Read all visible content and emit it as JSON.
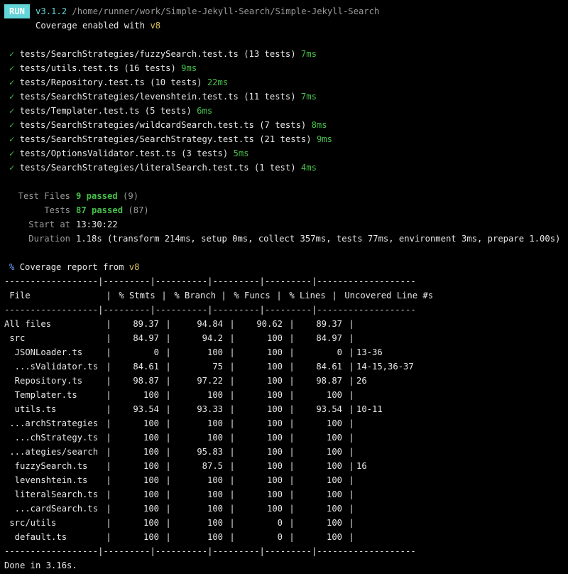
{
  "header": {
    "badge": "RUN",
    "version": "v3.1.2",
    "path": "/home/runner/work/Simple-Jekyll-Search/Simple-Jekyll-Search",
    "coverage_text": "Coverage enabled with ",
    "coverage_provider": "v8"
  },
  "tests": [
    {
      "check": "✓",
      "name": "tests/SearchStrategies/fuzzySearch.test.ts (13 tests)",
      "time": "7ms"
    },
    {
      "check": "✓",
      "name": "tests/utils.test.ts (16 tests)",
      "time": "9ms"
    },
    {
      "check": "✓",
      "name": "tests/Repository.test.ts (10 tests)",
      "time": "22ms"
    },
    {
      "check": "✓",
      "name": "tests/SearchStrategies/levenshtein.test.ts (11 tests)",
      "time": "7ms"
    },
    {
      "check": "✓",
      "name": "tests/Templater.test.ts (5 tests)",
      "time": "6ms"
    },
    {
      "check": "✓",
      "name": "tests/SearchStrategies/wildcardSearch.test.ts (7 tests)",
      "time": "8ms"
    },
    {
      "check": "✓",
      "name": "tests/SearchStrategies/SearchStrategy.test.ts (21 tests)",
      "time": "9ms"
    },
    {
      "check": "✓",
      "name": "tests/OptionsValidator.test.ts (3 tests)",
      "time": "5ms"
    },
    {
      "check": "✓",
      "name": "tests/SearchStrategies/literalSearch.test.ts (1 test)",
      "time": "4ms"
    }
  ],
  "summary": {
    "files_label": "Test Files",
    "files_passed": "9 passed",
    "files_total": "(9)",
    "tests_label": "Tests",
    "tests_passed": "87 passed",
    "tests_total": "(87)",
    "start_label": "Start at",
    "start_value": "13:30:22",
    "duration_label": "Duration",
    "duration_value": "1.18s",
    "duration_detail": "(transform 214ms, setup 0ms, collect 357ms, tests 77ms, environment 3ms, prepare 1.00s)"
  },
  "coverage": {
    "percent_sign": "%",
    "title": "Coverage report from ",
    "provider": "v8",
    "rule": "------------------|---------|----------|---------|---------|-------------------",
    "headers": [
      "File",
      "% Stmts",
      "% Branch",
      "% Funcs",
      "% Lines",
      "Uncovered Line #s"
    ],
    "rows": [
      {
        "file": "All files",
        "stmts": "89.37",
        "branch": "94.84",
        "funcs": "90.62",
        "lines": "89.37",
        "uncovered": ""
      },
      {
        "file": " src",
        "stmts": "84.97",
        "branch": "94.2",
        "funcs": "100",
        "lines": "84.97",
        "uncovered": ""
      },
      {
        "file": "  JSONLoader.ts",
        "stmts": "0",
        "branch": "100",
        "funcs": "100",
        "lines": "0",
        "uncovered": "13-36"
      },
      {
        "file": "  ...sValidator.ts",
        "stmts": "84.61",
        "branch": "75",
        "funcs": "100",
        "lines": "84.61",
        "uncovered": "14-15,36-37"
      },
      {
        "file": "  Repository.ts",
        "stmts": "98.87",
        "branch": "97.22",
        "funcs": "100",
        "lines": "98.87",
        "uncovered": "26"
      },
      {
        "file": "  Templater.ts",
        "stmts": "100",
        "branch": "100",
        "funcs": "100",
        "lines": "100",
        "uncovered": ""
      },
      {
        "file": "  utils.ts",
        "stmts": "93.54",
        "branch": "93.33",
        "funcs": "100",
        "lines": "93.54",
        "uncovered": "10-11"
      },
      {
        "file": " ...archStrategies",
        "stmts": "100",
        "branch": "100",
        "funcs": "100",
        "lines": "100",
        "uncovered": ""
      },
      {
        "file": "  ...chStrategy.ts",
        "stmts": "100",
        "branch": "100",
        "funcs": "100",
        "lines": "100",
        "uncovered": ""
      },
      {
        "file": " ...ategies/search",
        "stmts": "100",
        "branch": "95.83",
        "funcs": "100",
        "lines": "100",
        "uncovered": ""
      },
      {
        "file": "  fuzzySearch.ts",
        "stmts": "100",
        "branch": "87.5",
        "funcs": "100",
        "lines": "100",
        "uncovered": "16"
      },
      {
        "file": "  levenshtein.ts",
        "stmts": "100",
        "branch": "100",
        "funcs": "100",
        "lines": "100",
        "uncovered": ""
      },
      {
        "file": "  literalSearch.ts",
        "stmts": "100",
        "branch": "100",
        "funcs": "100",
        "lines": "100",
        "uncovered": ""
      },
      {
        "file": "  ...cardSearch.ts",
        "stmts": "100",
        "branch": "100",
        "funcs": "100",
        "lines": "100",
        "uncovered": ""
      },
      {
        "file": " src/utils",
        "stmts": "100",
        "branch": "100",
        "funcs": "0",
        "lines": "100",
        "uncovered": ""
      },
      {
        "file": "  default.ts",
        "stmts": "100",
        "branch": "100",
        "funcs": "0",
        "lines": "100",
        "uncovered": ""
      }
    ]
  },
  "footer": {
    "done": "Done in 3.16s."
  },
  "colors": {
    "background": "#000000",
    "badge": "#63d4d8",
    "pass_green": "#47c04a",
    "provider_yellow": "#d7c15a",
    "dim_gray": "#9a9a9a"
  }
}
